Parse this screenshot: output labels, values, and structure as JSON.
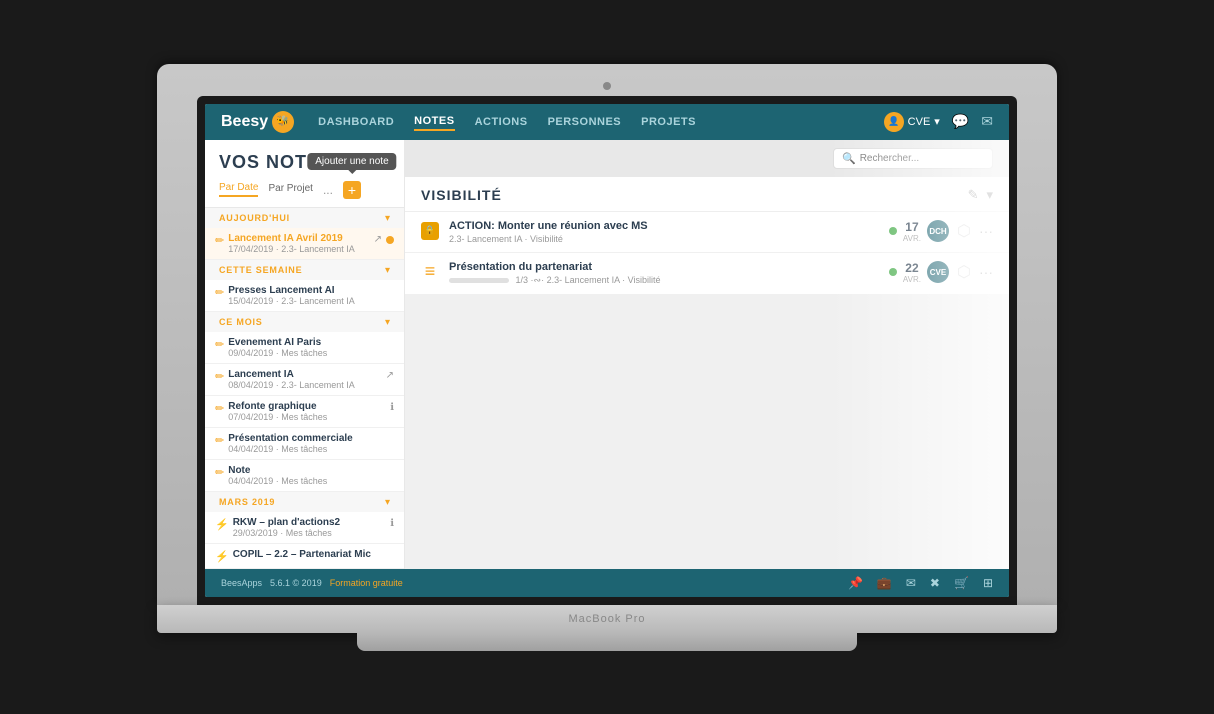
{
  "laptop": {
    "brand": "MacBook Pro"
  },
  "nav": {
    "logo": "Beesy",
    "items": [
      {
        "label": "DASHBOARD",
        "active": false
      },
      {
        "label": "NOTES",
        "active": true
      },
      {
        "label": "ACTIONS",
        "active": false
      },
      {
        "label": "PERSONNES",
        "active": false
      },
      {
        "label": "PROJETS",
        "active": false
      }
    ],
    "user": "CVE",
    "user_caret": "▾"
  },
  "sidebar": {
    "title": "VOS NOTES",
    "tabs": [
      {
        "label": "Par Date",
        "active": true
      },
      {
        "label": "Par Projet",
        "active": false
      },
      {
        "label": "...",
        "active": false
      }
    ],
    "add_tooltip": "Ajouter une note",
    "sections": [
      {
        "title": "AUJOURD'HUI",
        "items": [
          {
            "title": "Lancement IA Avril 2019",
            "meta": "17/04/2019 · 2.3- Lancement IA",
            "has_badge": true,
            "has_share": true,
            "title_color": "orange"
          }
        ]
      },
      {
        "title": "CETTE SEMAINE",
        "items": [
          {
            "title": "Presses Lancement AI",
            "meta": "15/04/2019 · 2.3- Lancement IA",
            "has_badge": false,
            "has_share": false,
            "title_color": "dark"
          }
        ]
      },
      {
        "title": "CE MOIS",
        "items": [
          {
            "title": "Evenement AI Paris",
            "meta": "09/04/2019 · Mes tâches",
            "has_badge": false,
            "title_color": "dark"
          },
          {
            "title": "Lancement IA",
            "meta": "08/04/2019 · 2.3- Lancement IA",
            "has_badge": false,
            "has_share": true,
            "title_color": "dark"
          },
          {
            "title": "Refonte graphique",
            "meta": "07/04/2019 · Mes tâches",
            "has_badge": false,
            "has_info": true,
            "title_color": "dark"
          },
          {
            "title": "Présentation commerciale",
            "meta": "04/04/2019 · Mes tâches",
            "has_badge": false,
            "title_color": "dark"
          },
          {
            "title": "Note",
            "meta": "04/04/2019 · Mes tâches",
            "has_badge": false,
            "title_color": "dark"
          }
        ]
      },
      {
        "title": "MARS 2019",
        "items": [
          {
            "title": "RKW – plan d'actions2",
            "meta": "29/03/2019 · Mes tâches",
            "has_badge": false,
            "has_info": true,
            "title_color": "dark"
          },
          {
            "title": "COPIL – 2.2 – Partenariat Mic",
            "meta": "",
            "has_badge": false,
            "title_color": "dark"
          }
        ]
      }
    ]
  },
  "note_panel": {
    "title": "VISIBILITÉ",
    "search_placeholder": "Rechercher...",
    "actions": [
      {
        "type": "lock",
        "title": "ACTION: Monter une réunion avec MS",
        "sub": "2.3- Lancement IA · Visibilité",
        "date_day": "17",
        "date_month": "AVR.",
        "assignee": "DCH",
        "progress": null
      },
      {
        "type": "strikethrough",
        "title": "Présentation du partenariat",
        "sub": "1/3 ·∾· 2.3- Lancement IA · Visibilité",
        "date_day": "22",
        "date_month": "AVR.",
        "assignee": "CVE",
        "progress": 30
      }
    ]
  },
  "bottombar": {
    "brand": "BeesApps",
    "version": "5.6.1 © 2019",
    "cta": "Formation gratuite",
    "icons": [
      "pin",
      "briefcase",
      "envelope",
      "circle-x",
      "cart",
      "grid"
    ]
  }
}
